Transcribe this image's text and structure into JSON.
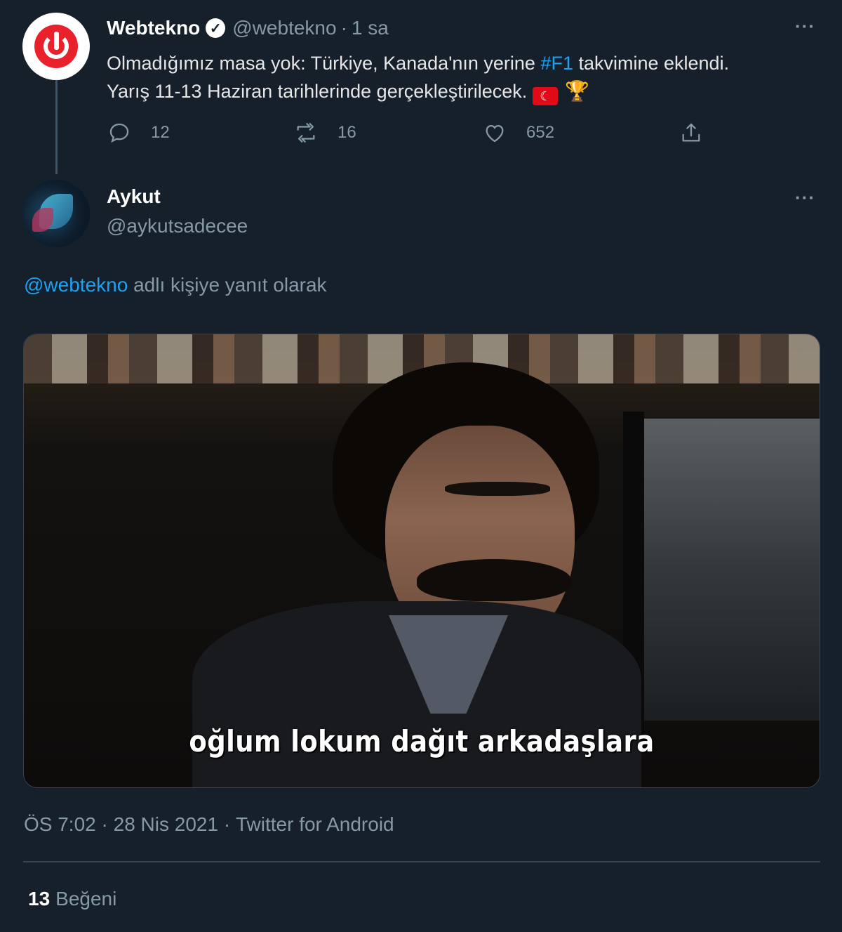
{
  "parent_tweet": {
    "display_name": "Webtekno",
    "handle": "@webtekno",
    "separator": "·",
    "time": "1 sa",
    "text_before_hashtag": "Olmadığımız masa yok: Türkiye, Kanada'nın yerine ",
    "hashtag": "#F1",
    "text_after_hashtag": " takvimine eklendi.",
    "text_line2": "Yarış 11-13 Haziran tarihlerinde gerçekleştirilecek.",
    "emoji_flag": "turkey-flag",
    "emoji_trophy": "trophy",
    "more_label": "···",
    "actions": {
      "reply_count": "12",
      "retweet_count": "16",
      "like_count": "652"
    }
  },
  "reply_tweet": {
    "display_name": "Aykut",
    "handle": "@aykutsadecee",
    "more_label": "···",
    "replying_mention": "@webtekno",
    "replying_text": " adlı kişiye yanıt olarak",
    "media_caption": "oğlum lokum dağıt arkadaşlara",
    "time": "ÖS 7:02",
    "date": "28 Nis 2021",
    "source": "Twitter for Android",
    "meta_separator": " · ",
    "likes_count": "13",
    "likes_label": "Beğeni"
  },
  "colors": {
    "background": "#15202b",
    "link": "#1da1f2",
    "secondary_text": "#8899a6",
    "webtekno_red": "#e8212b",
    "turkey_red": "#e30a17"
  }
}
